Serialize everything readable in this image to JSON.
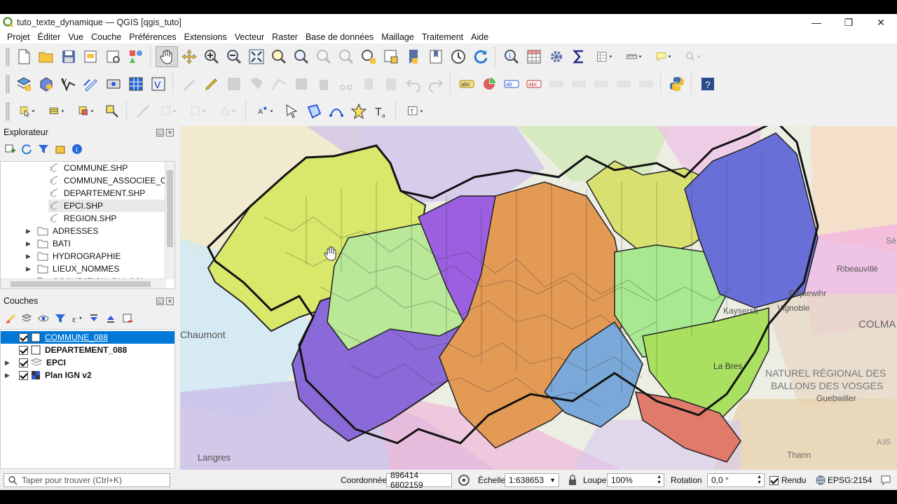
{
  "window": {
    "title": "tuto_texte_dynamique — QGIS [qgis_tuto]",
    "minimize": "—",
    "restore": "❐",
    "close": "✕"
  },
  "menu": [
    "Projet",
    "Éditer",
    "Vue",
    "Couche",
    "Préférences",
    "Extensions",
    "Vecteur",
    "Raster",
    "Base de données",
    "Maillage",
    "Traitement",
    "Aide"
  ],
  "browser_panel": {
    "title": "Explorateur",
    "items": [
      {
        "label": "COMMUNE.SHP",
        "type": "shp"
      },
      {
        "label": "COMMUNE_ASSOCIEE_OU_",
        "type": "shp"
      },
      {
        "label": "DEPARTEMENT.SHP",
        "type": "shp"
      },
      {
        "label": "EPCI.SHP",
        "type": "shp"
      },
      {
        "label": "REGION.SHP",
        "type": "shp"
      },
      {
        "label": "ADRESSES",
        "type": "folder"
      },
      {
        "label": "BATI",
        "type": "folder"
      },
      {
        "label": "HYDROGRAPHIE",
        "type": "folder"
      },
      {
        "label": "LIEUX_NOMMES",
        "type": "folder"
      },
      {
        "label": "OCCUPATION_DU_SOL",
        "type": "folder"
      }
    ]
  },
  "layers_panel": {
    "title": "Couches",
    "layers": [
      {
        "label": "COMMUNE_088",
        "checked": true,
        "selected": true
      },
      {
        "label": "DEPARTEMENT_088",
        "checked": true,
        "selected": false
      },
      {
        "label": "EPCI",
        "checked": true,
        "selected": false
      },
      {
        "label": "Plan IGN v2",
        "checked": true,
        "selected": false
      }
    ]
  },
  "map_labels": {
    "chaumont": "Chaumont",
    "langres": "Langres",
    "colmar": "COLMA",
    "pnr_line1": "NATUREL RÉGIONAL DES",
    "pnr_line2": "BALLONS DES VOSGES",
    "guebwiller": "Guebwiller",
    "thann": "Thann",
    "ribeauville": "Ribeauvillé",
    "riquewihr": "Riquewihr",
    "kaysersberg": "Kaysersb",
    "vignoble": "Vignoble",
    "la_bresse": "La Bres",
    "a35": "A35",
    "sel": "Sé"
  },
  "status": {
    "search_placeholder": "Taper pour trouver (Ctrl+K)",
    "coord_label": "Coordonnée",
    "coord_value": "896414 6802159",
    "scale_label": "Échelle",
    "scale_value": "1:638653",
    "magnifier_label": "Loupe",
    "magnifier_value": "100%",
    "rotation_label": "Rotation",
    "rotation_value": "0,0 °",
    "render_label": "Rendu",
    "crs": "EPSG:2154"
  },
  "colors": {
    "selection": "#0078d7",
    "yellow_epci": "#d8e86a",
    "purple_epci": "#9b5fe0",
    "orange_epci": "#e39a55",
    "blue_epci": "#6870d8",
    "lightgreen_epci": "#a8e890",
    "green_epci": "#a9e060",
    "violet_epci": "#8a6ad8",
    "steelblue_epci": "#7aa8d8",
    "red_epci": "#e07a6a"
  }
}
